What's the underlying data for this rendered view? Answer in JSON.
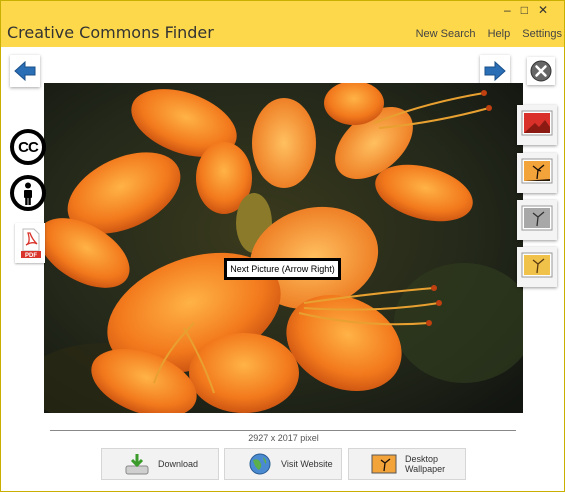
{
  "window": {
    "title": "Creative Commons Finder",
    "controls": [
      "–",
      "□",
      "✕"
    ]
  },
  "menu": {
    "new_search": "New Search",
    "help": "Help",
    "settings": "Settings"
  },
  "nav": {
    "prev_icon": "arrow-left-icon",
    "next_icon": "arrow-right-icon",
    "close_icon": "close-circle-icon"
  },
  "license": {
    "cc_text": "CC",
    "by_icon": "attribution-person-icon",
    "pdf_label": "PDF"
  },
  "tooltip": {
    "text": "Next Picture (Arrow Right)"
  },
  "thumbnails": [
    {
      "icon": "red-tinted-photo-thumbnail-icon"
    },
    {
      "icon": "tree-sunset-photo-thumbnail-icon"
    },
    {
      "icon": "gray-photo-thumbnail-icon"
    },
    {
      "icon": "yellow-photo-thumbnail-icon"
    }
  ],
  "image": {
    "size_text": "2927 x 2017 pixel"
  },
  "actions": {
    "download": "Download",
    "visit": "Visit Website",
    "wallpaper": "Desktop Wallpaper"
  },
  "colors": {
    "titlebar": "#fdd84a",
    "arrow_blue": "#2a6fb6",
    "pdf_red": "#d9342b"
  }
}
